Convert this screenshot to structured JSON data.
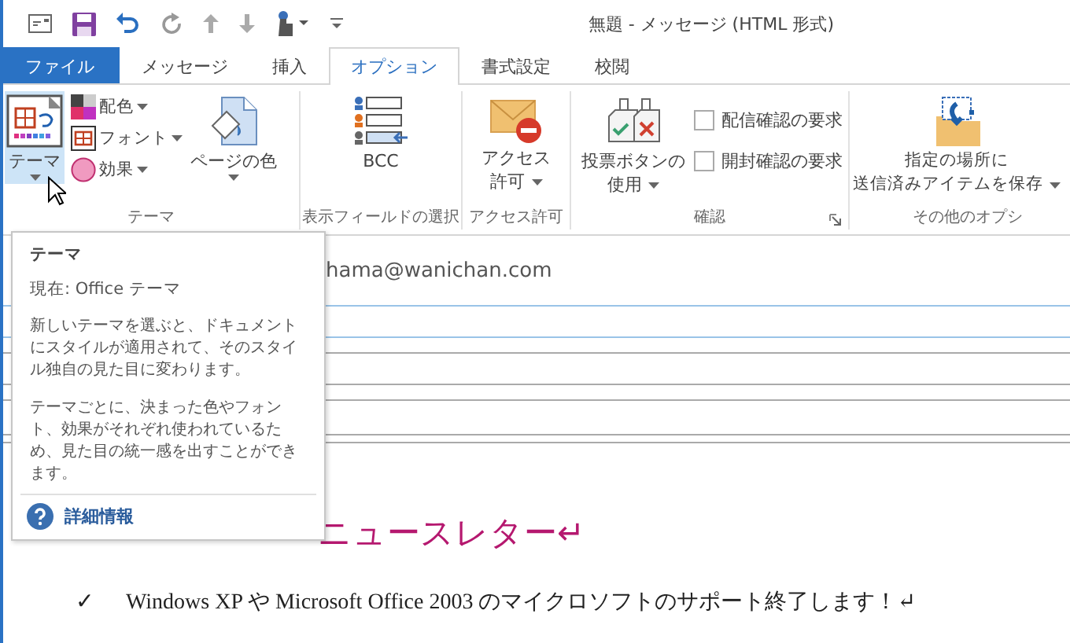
{
  "window": {
    "title": "無題 - メッセージ (HTML 形式)"
  },
  "tabs": [
    {
      "label": "ファイル",
      "kind": "file",
      "selected": false
    },
    {
      "label": "メッセージ",
      "kind": "tab",
      "selected": false
    },
    {
      "label": "挿入",
      "kind": "tab",
      "selected": false
    },
    {
      "label": "オプション",
      "kind": "tab",
      "selected": true
    },
    {
      "label": "書式設定",
      "kind": "tab",
      "selected": false
    },
    {
      "label": "校閲",
      "kind": "tab",
      "selected": false
    }
  ],
  "ribbon": {
    "groups": [
      {
        "label": "テーマ",
        "controls": [
          {
            "kind": "large",
            "lines": [
              "テーマ"
            ],
            "dropdown": true,
            "highlighted": true
          },
          {
            "kind": "stack",
            "items": [
              {
                "label": "配色",
                "dropdown": true
              },
              {
                "label": "フォント",
                "dropdown": true
              },
              {
                "label": "効果",
                "dropdown": true
              }
            ]
          },
          {
            "kind": "large",
            "lines": [
              "ページの色"
            ],
            "dropdown": true,
            "highlighted": false
          }
        ]
      },
      {
        "label": "表示フィールドの選択",
        "controls": [
          {
            "kind": "large",
            "lines": [
              "BCC"
            ],
            "highlighted": false
          }
        ]
      },
      {
        "label": "アクセス許可",
        "controls": [
          {
            "kind": "large",
            "lines": [
              "アクセス",
              "許可"
            ],
            "dropdown": true,
            "highlighted": false
          }
        ]
      },
      {
        "label": "確認",
        "launcher": true,
        "controls": [
          {
            "kind": "large",
            "lines": [
              "投票ボタンの",
              "使用"
            ],
            "dropdown": true,
            "highlighted": false
          },
          {
            "kind": "checks",
            "items": [
              {
                "label": "配信確認の要求",
                "checked": false
              },
              {
                "label": "開封確認の要求",
                "checked": false
              }
            ]
          }
        ]
      },
      {
        "label": "その他のオプシ",
        "controls": [
          {
            "kind": "large",
            "lines": [
              "指定の場所に",
              "送信済みアイテムを保存"
            ],
            "dropdown": true,
            "highlighted": false
          }
        ]
      }
    ]
  },
  "message": {
    "to": "hama@wanichan.com",
    "headline": "ニュースレター↵",
    "bullet": "✓",
    "line": "Windows XP や Microsoft Office 2003 のマイクロソフトのサポート終了します！↵"
  },
  "tooltip": {
    "title": "テーマ",
    "current": "現在: Office テーマ",
    "paragraphs": [
      "新しいテーマを選ぶと、ドキュメントにスタイルが適用されて、そのスタイル独自の見た目に変わります。",
      "テーマごとに、決まった色やフォント、効果がそれぞれ使われているため、見た目の統一感を出すことができます。"
    ],
    "link": "詳細情報"
  }
}
